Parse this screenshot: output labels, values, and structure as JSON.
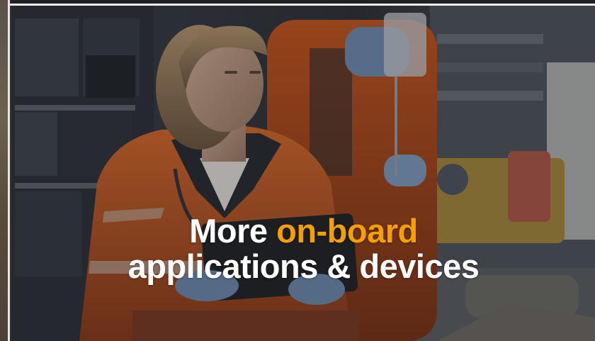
{
  "headline": {
    "line1_prefix": "More",
    "line1_accent": "on-board",
    "line2": "applications & devices"
  },
  "colors": {
    "text": "#ffffff",
    "accent": "#f5a000",
    "uniform": "#e0621f"
  },
  "image": {
    "subject": "paramedics-in-ambulance-photo"
  }
}
